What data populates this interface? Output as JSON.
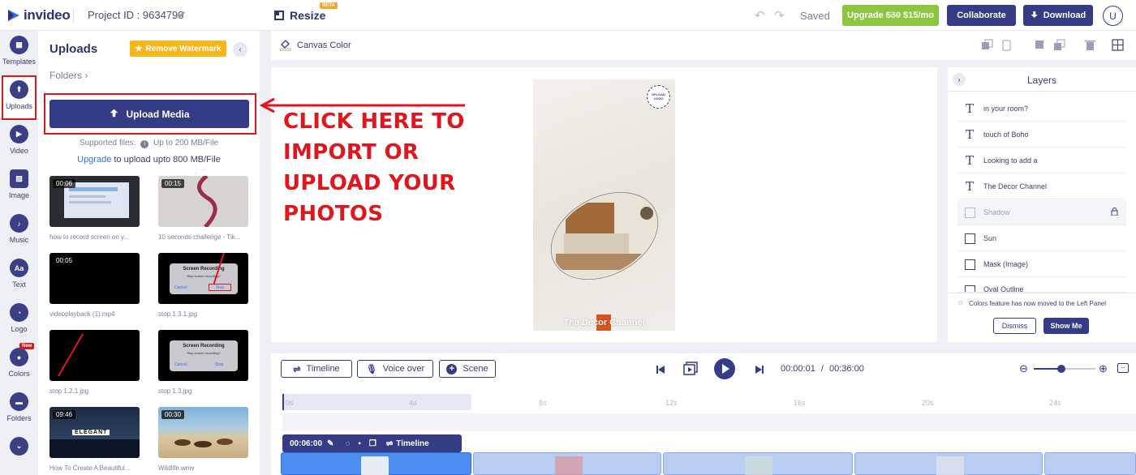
{
  "header": {
    "logo_text": "invideo",
    "project_id": "Project ID : 9634790",
    "resize_label": "Resize",
    "beta_badge": "BETA",
    "saved_status": "Saved",
    "upgrade_prefix": "Upgrade",
    "upgrade_old_price": "$30",
    "upgrade_new_price": "$15/mo",
    "collaborate": "Collaborate",
    "download": "Download",
    "avatar_initial": "U"
  },
  "rail": {
    "items": [
      {
        "label": "Templates",
        "icon": "templates-icon"
      },
      {
        "label": "Uploads",
        "icon": "upload-icon"
      },
      {
        "label": "Video",
        "icon": "video-icon"
      },
      {
        "label": "Image",
        "icon": "image-icon"
      },
      {
        "label": "Music",
        "icon": "music-icon"
      },
      {
        "label": "Text",
        "icon": "text-icon"
      },
      {
        "label": "Logo",
        "icon": "logo-icon"
      },
      {
        "label": "Colors",
        "icon": "colors-icon"
      },
      {
        "label": "Folders",
        "icon": "folders-icon"
      }
    ],
    "new_badge": "New"
  },
  "uploads": {
    "title": "Uploads",
    "remove_watermark": "Remove Watermark",
    "folders": "Folders",
    "upload_media": "Upload Media",
    "supported": "Supported files:",
    "supported_limit": "Up to 200 MB/File",
    "upgrade_link": "Upgrade",
    "upgrade_rest": " to upload upto 800 MB/File",
    "items": [
      {
        "time": "00:06",
        "caption": "how to record screen on y..."
      },
      {
        "time": "00:15",
        "caption": "10 seconds challenge - Tik..."
      },
      {
        "time": "00:05",
        "caption": "videoplayback (1).mp4"
      },
      {
        "time": "",
        "caption": "stop 1.3.1.jpg"
      },
      {
        "time": "",
        "caption": "stop 1.2.1.jpg"
      },
      {
        "time": "",
        "caption": "stop 1.3.jpg"
      },
      {
        "time": "09:46",
        "caption": "How To Create A Beautiful..."
      },
      {
        "time": "00:30",
        "caption": "Wildlife.wmv"
      }
    ],
    "thumb_screen_recording": "Screen Recording",
    "thumb_stop_prompt": "Stop screen recording?",
    "thumb_cancel": "Cancel",
    "thumb_stop": "Stop",
    "thumb_elegant": "ELEGANT"
  },
  "toolbar": {
    "canvas_color": "Canvas Color"
  },
  "canvas": {
    "upload_logo": "UPLOAD LOGO",
    "channel_title": "The Decor Channel"
  },
  "callout": {
    "lines": [
      "CLICK HERE TO",
      "IMPORT OR",
      "UPLOAD YOUR",
      "PHOTOS"
    ]
  },
  "layers": {
    "title": "Layers",
    "items": [
      {
        "label": "in your room?",
        "type": "text"
      },
      {
        "label": "touch of Boho",
        "type": "text"
      },
      {
        "label": "Looking to add a",
        "type": "text"
      },
      {
        "label": "The Decor Channel",
        "type": "text"
      },
      {
        "label": "Shadow",
        "type": "shape"
      },
      {
        "label": "Sun",
        "type": "shape"
      },
      {
        "label": "Mask (Image)",
        "type": "image"
      },
      {
        "label": "Oval Outline",
        "type": "shape"
      }
    ],
    "notice": "Colors feature has now moved to the Left Panel",
    "dismiss": "Dismiss",
    "show_me": "Show Me"
  },
  "timeline": {
    "timeline_btn": "Timeline",
    "voice_over_btn": "Voice over",
    "scene_btn": "Scene",
    "current_time": "00:00:01",
    "time_sep": "/",
    "total_time": "00:36:00",
    "ticks": [
      "0s",
      "4s",
      "8s",
      "12s",
      "16s",
      "20s",
      "24s"
    ],
    "scene_duration": "00:06:00",
    "scene_timeline_label": "Timeline"
  }
}
